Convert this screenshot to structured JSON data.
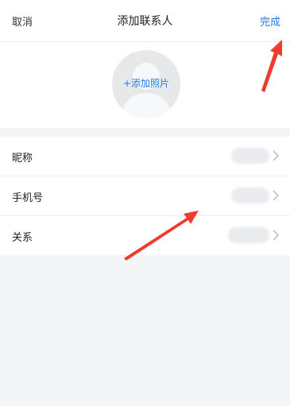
{
  "nav": {
    "cancel_label": "取消",
    "title": "添加联系人",
    "done_label": "完成"
  },
  "photo": {
    "add_photo_label": "+添加照片"
  },
  "form": {
    "rows": [
      {
        "label": "昵称"
      },
      {
        "label": "手机号"
      },
      {
        "label": "关系"
      }
    ]
  },
  "colors": {
    "accent": "#1f7ce8",
    "annotation_arrow": "#f03a2e",
    "page_background": "#f4f5f7"
  },
  "icons": {
    "avatar": "person-placeholder-icon",
    "row_arrow": "chevron-right-icon",
    "annotation": "arrow-annotation"
  }
}
